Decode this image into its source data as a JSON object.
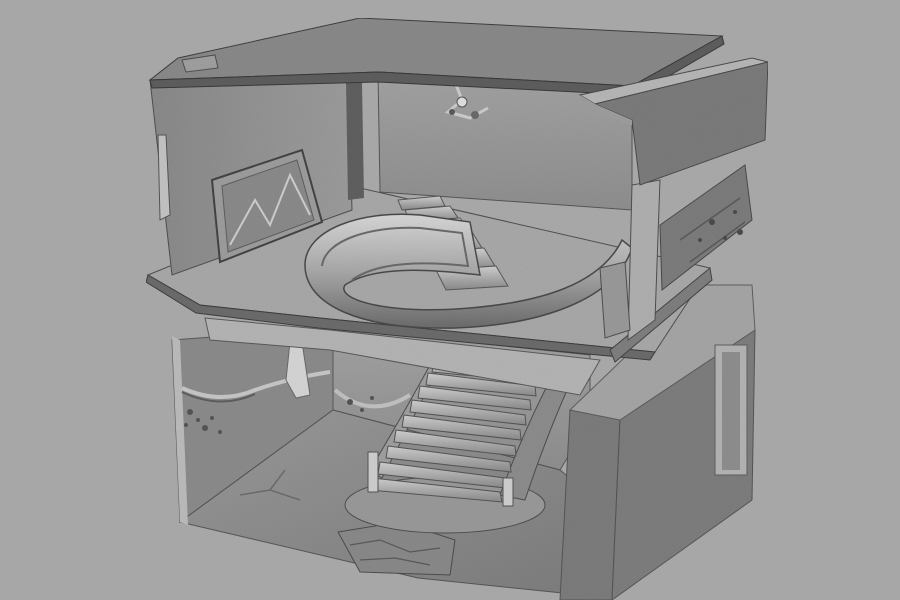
{
  "viewport": {
    "background": "#a7a7a7",
    "render_style": "grayscale-shaded-3d-scan"
  },
  "model": {
    "subject": "two-story-cutaway-scan",
    "upper_floor": {
      "contents": [
        "staircase",
        "curved-railing",
        "tilted-picture-frame",
        "ceiling-fixture"
      ]
    },
    "lower_floor": {
      "contents": [
        "curved-grand-staircase",
        "draped-garlands",
        "floor-debris"
      ]
    }
  },
  "palette": {
    "light": "#d2d2d2",
    "mid": "#8e8e8e",
    "dark": "#5d5d5d",
    "shadow": "#3e3e3e"
  }
}
